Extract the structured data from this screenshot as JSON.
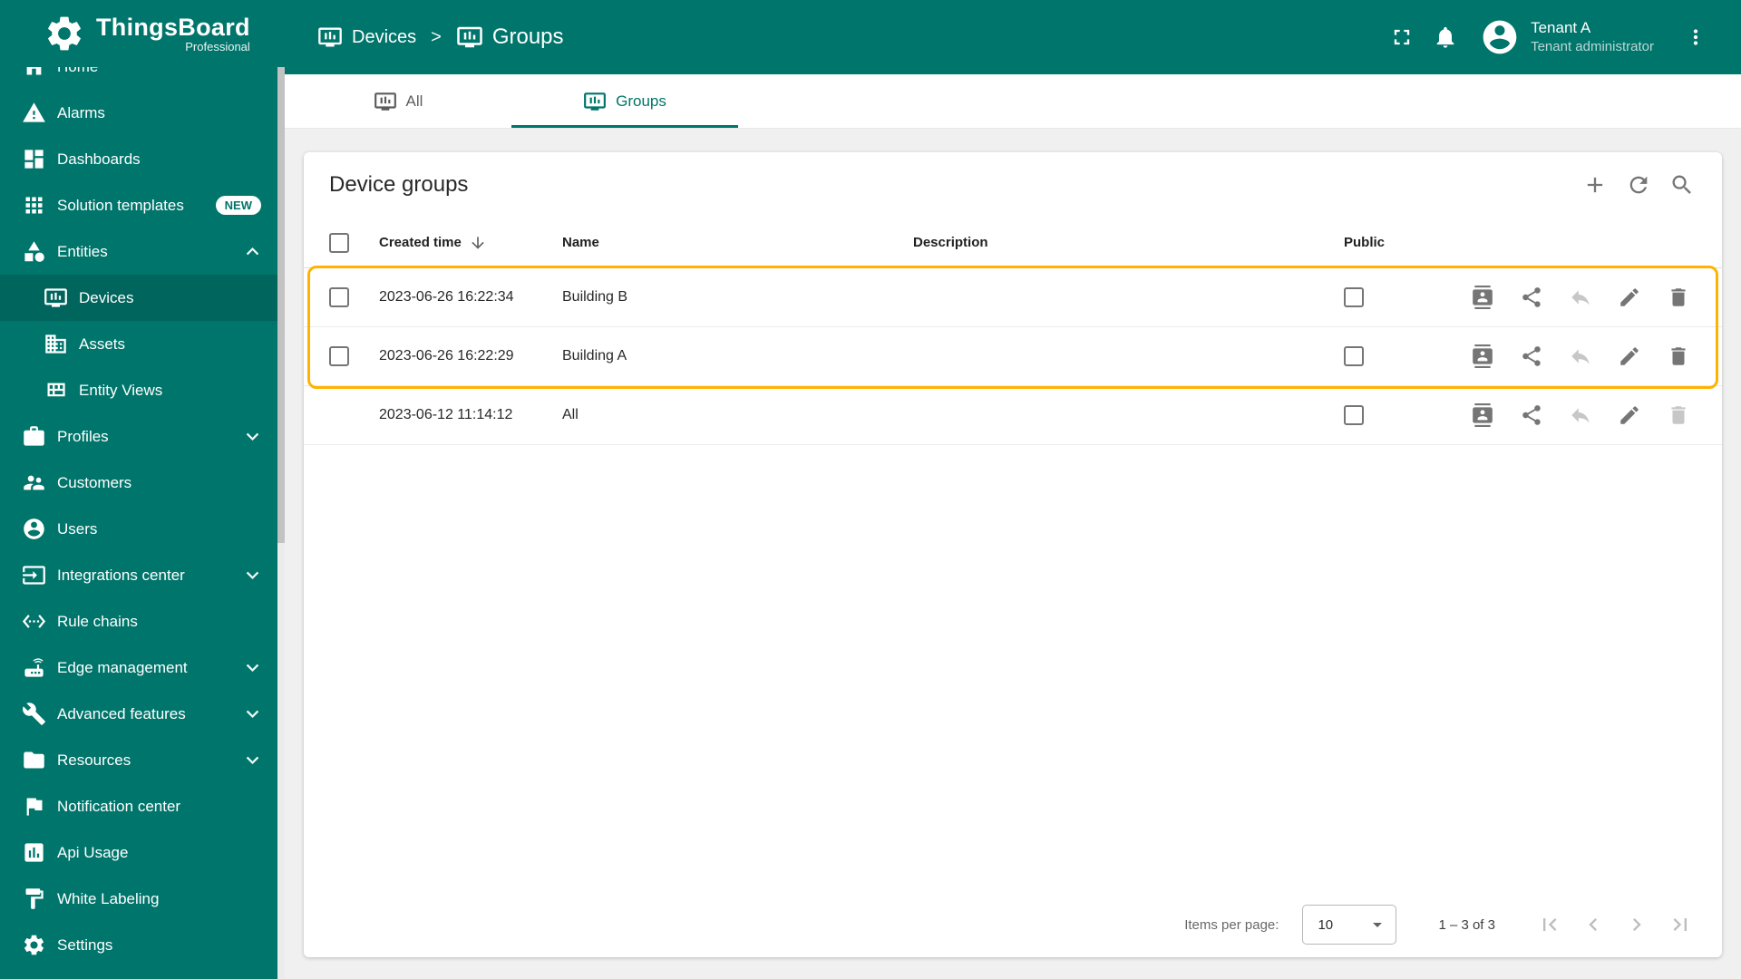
{
  "app": {
    "name": "ThingsBoard",
    "tagline": "Professional"
  },
  "colors": {
    "primary": "#00756B",
    "active_item": "#00655C",
    "highlight": "#FFB300"
  },
  "header": {
    "breadcrumb": [
      {
        "label": "Devices"
      },
      {
        "label": "Groups"
      }
    ],
    "user": {
      "name": "Tenant A",
      "role": "Tenant administrator"
    }
  },
  "sidebar": {
    "items": [
      {
        "label": "Home",
        "icon": "home"
      },
      {
        "label": "Alarms",
        "icon": "alarms"
      },
      {
        "label": "Dashboards",
        "icon": "dashboards"
      },
      {
        "label": "Solution templates",
        "icon": "solution-templates",
        "badge": "NEW"
      },
      {
        "label": "Entities",
        "icon": "entities",
        "expand": "up"
      },
      {
        "label": "Devices",
        "icon": "device-group",
        "sub": true,
        "active": true
      },
      {
        "label": "Assets",
        "icon": "assets",
        "sub": true
      },
      {
        "label": "Entity Views",
        "icon": "entity-views",
        "sub": true
      },
      {
        "label": "Profiles",
        "icon": "profiles",
        "expand": "down"
      },
      {
        "label": "Customers",
        "icon": "customers"
      },
      {
        "label": "Users",
        "icon": "users"
      },
      {
        "label": "Integrations center",
        "icon": "integrations",
        "expand": "down"
      },
      {
        "label": "Rule chains",
        "icon": "rule-chains"
      },
      {
        "label": "Edge management",
        "icon": "edge",
        "expand": "down"
      },
      {
        "label": "Advanced features",
        "icon": "advanced",
        "expand": "down"
      },
      {
        "label": "Resources",
        "icon": "resources",
        "expand": "down"
      },
      {
        "label": "Notification center",
        "icon": "notification"
      },
      {
        "label": "Api Usage",
        "icon": "api-usage"
      },
      {
        "label": "White Labeling",
        "icon": "white-labeling"
      },
      {
        "label": "Settings",
        "icon": "settings"
      }
    ]
  },
  "tabs": [
    {
      "label": "All"
    },
    {
      "label": "Groups"
    }
  ],
  "card": {
    "title": "Device groups"
  },
  "table": {
    "columns": {
      "created": "Created time",
      "name": "Name",
      "description": "Description",
      "public": "Public"
    },
    "row_actions": [
      "manage-owners",
      "share",
      "make-private",
      "edit",
      "delete"
    ],
    "rows": [
      {
        "created": "2023-06-26 16:22:34",
        "name": "Building B",
        "description": "",
        "public": false,
        "selectable": true,
        "highlighted": true,
        "delete_disabled": false
      },
      {
        "created": "2023-06-26 16:22:29",
        "name": "Building A",
        "description": "",
        "public": false,
        "selectable": true,
        "highlighted": true,
        "delete_disabled": false
      },
      {
        "created": "2023-06-12 11:14:12",
        "name": "All",
        "description": "",
        "public": false,
        "selectable": false,
        "highlighted": false,
        "delete_disabled": true
      }
    ]
  },
  "pagination": {
    "items_per_page_label": "Items per page:",
    "page_size": "10",
    "range": "1 – 3 of 3"
  }
}
